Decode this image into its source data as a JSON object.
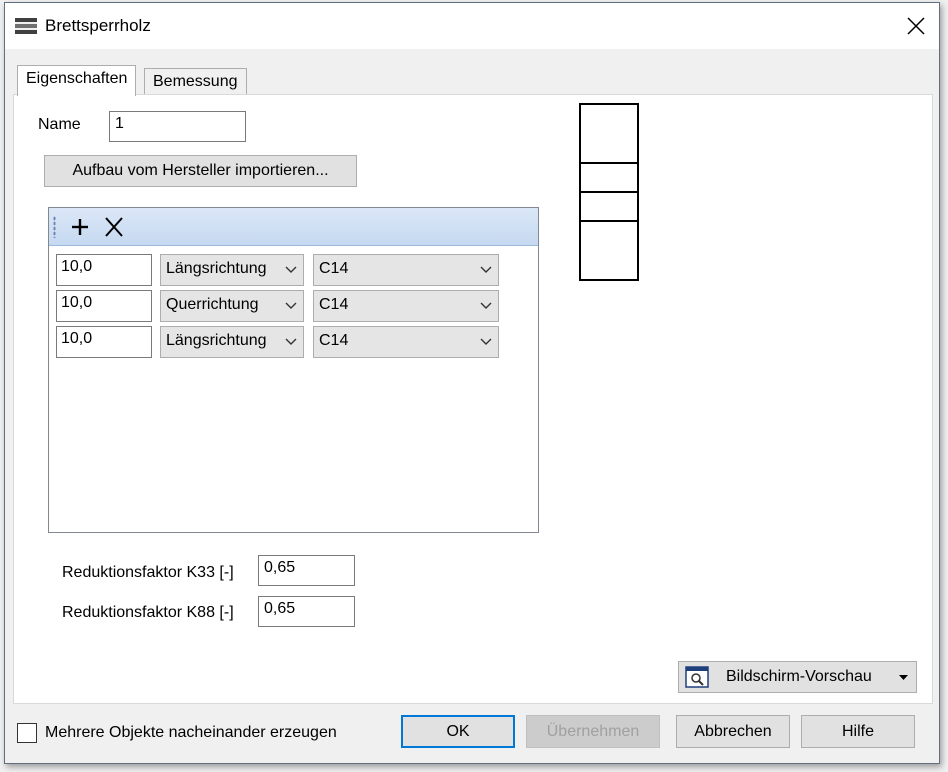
{
  "window": {
    "title": "Brettsperrholz",
    "title_icon": "layers-icon",
    "close_icon": "close-icon"
  },
  "tabs": [
    {
      "label": "Eigenschaften",
      "active": true
    },
    {
      "label": "Bemessung",
      "active": false
    }
  ],
  "properties": {
    "name_label": "Name",
    "name_value": "1",
    "import_button": "Aufbau vom Hersteller importieren...",
    "toolbar": {
      "add_icon": "plus-icon",
      "delete_icon": "cross-icon"
    },
    "layers": [
      {
        "thickness": "10,0",
        "direction": "Längsrichtung",
        "material": "C14"
      },
      {
        "thickness": "10,0",
        "direction": "Querrichtung",
        "material": "C14"
      },
      {
        "thickness": "10,0",
        "direction": "Längsrichtung",
        "material": "C14"
      }
    ],
    "k33_label": "Reduktionsfaktor K33 [-]",
    "k33_value": "0,65",
    "k88_label": "Reduktionsfaktor K88 [-]",
    "k88_value": "0,65",
    "preview_mode": "Bildschirm-Vorschau",
    "preview_mode_icon": "screen-preview-icon"
  },
  "footer": {
    "multiple_objects_label": "Mehrere Objekte nacheinander erzeugen",
    "multiple_objects_checked": false,
    "ok": "OK",
    "apply": "Übernehmen",
    "cancel": "Abbrechen",
    "help": "Hilfe"
  },
  "colors": {
    "accent": "#0078d7",
    "toolbar": "#c5d9f1"
  }
}
